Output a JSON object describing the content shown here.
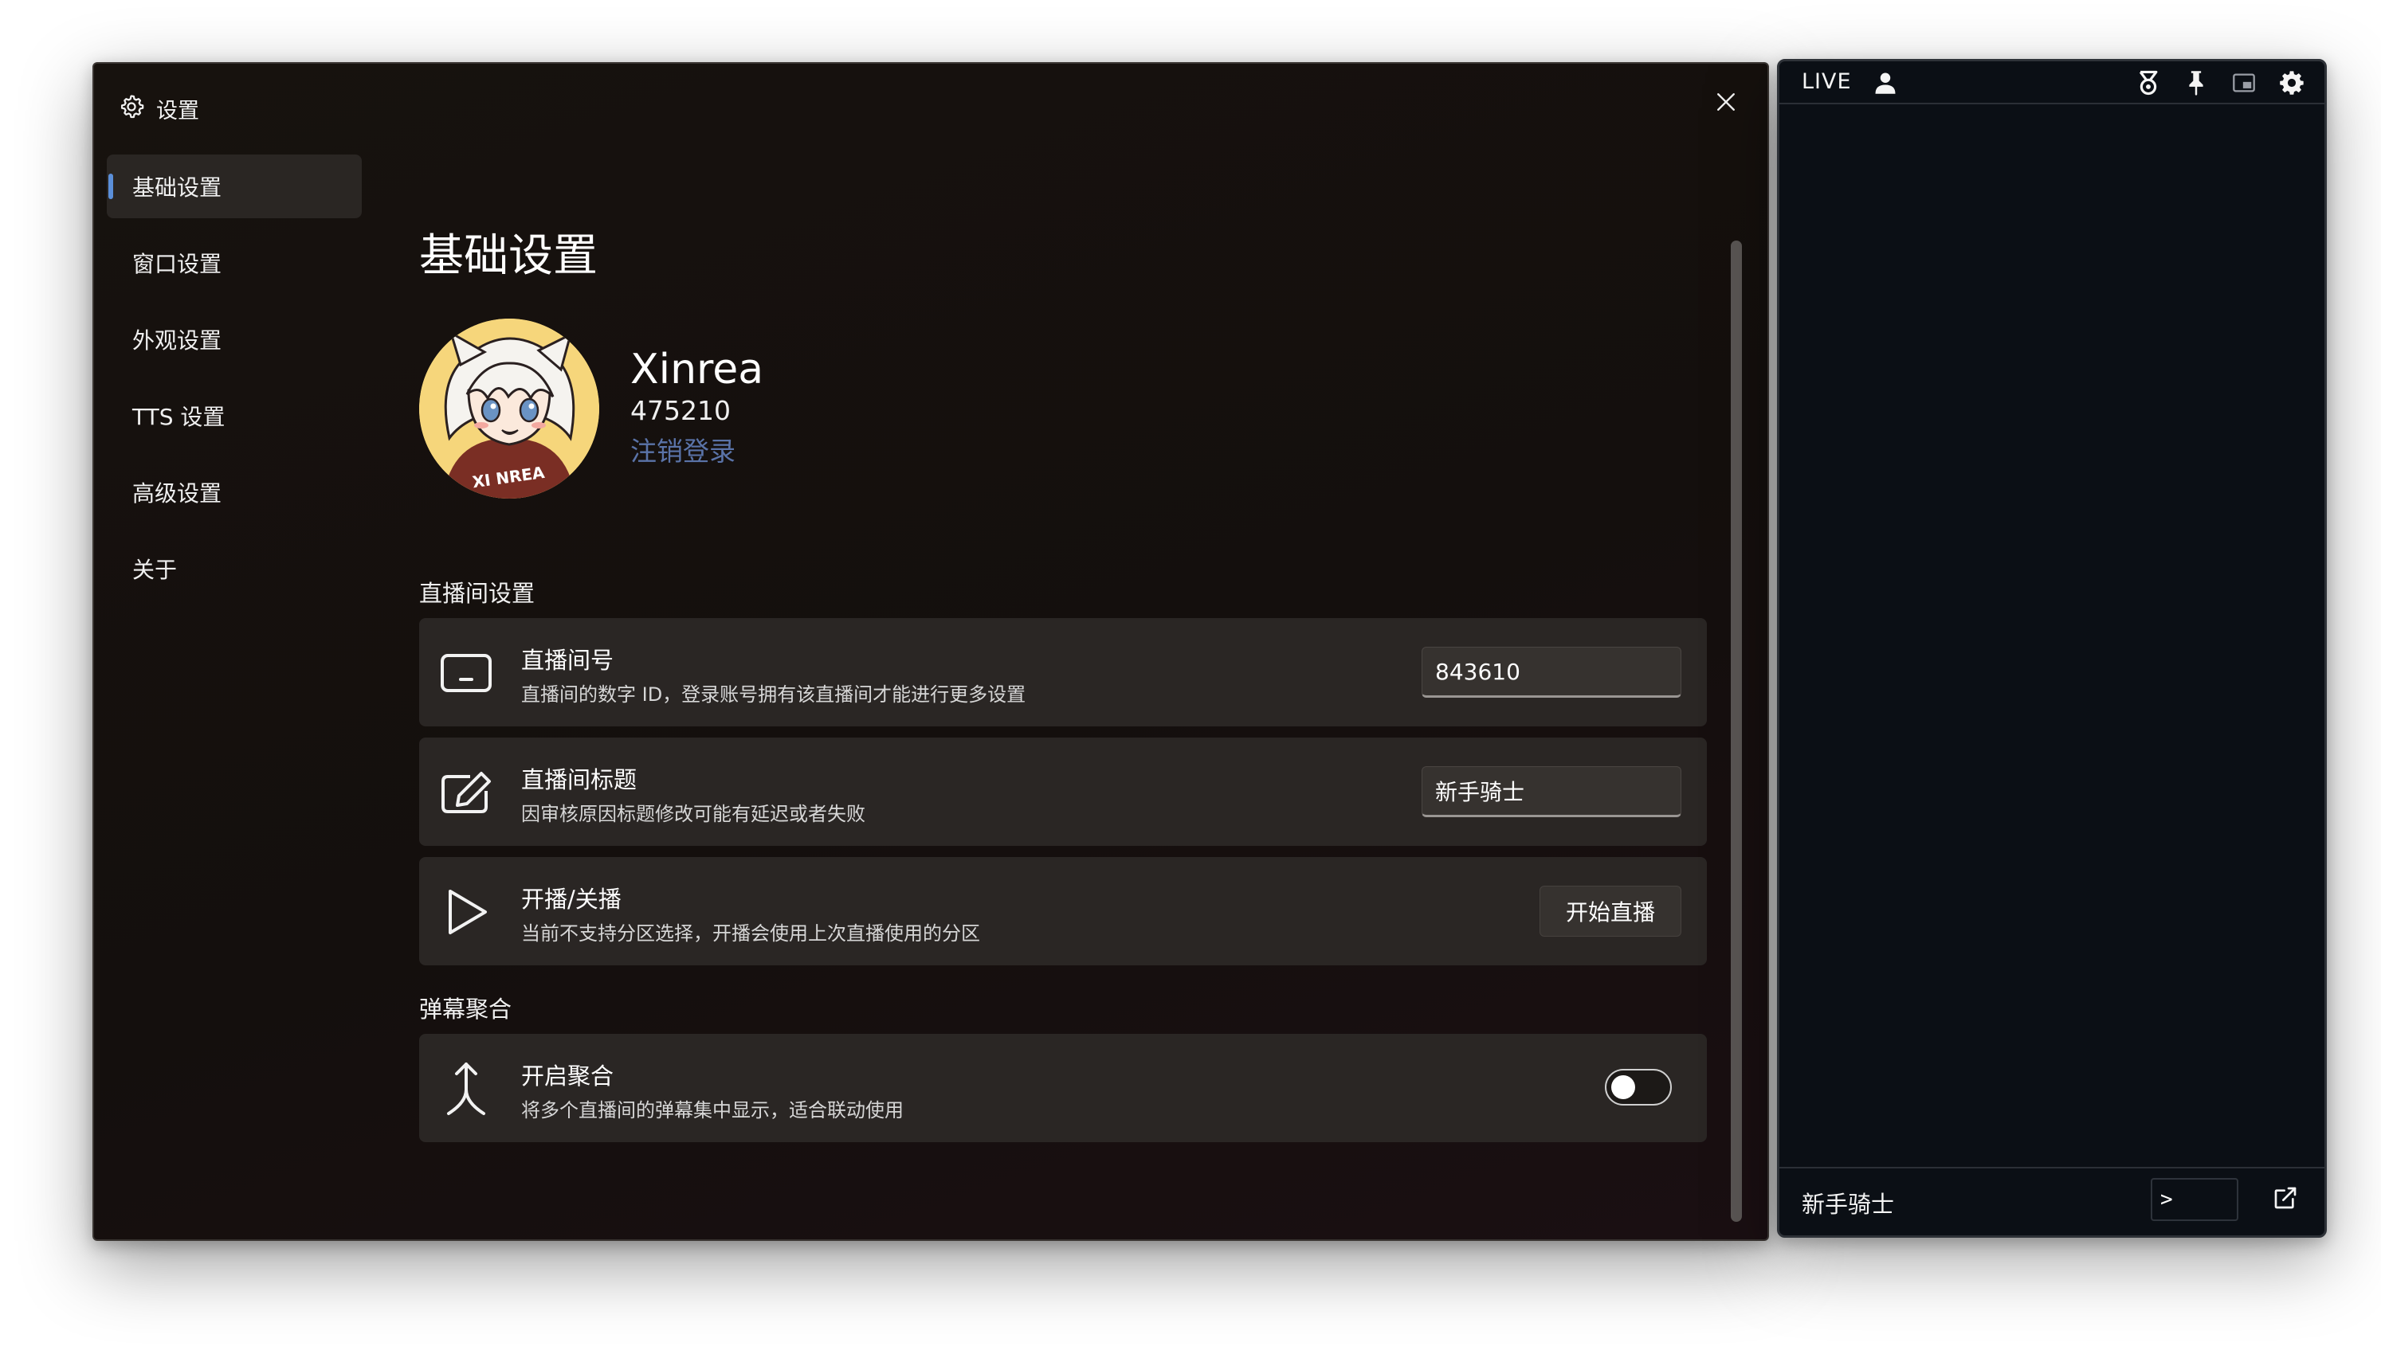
{
  "settings_window": {
    "title": "设置",
    "sidebar": {
      "items": [
        {
          "label": "基础设置",
          "active": true
        },
        {
          "label": "窗口设置"
        },
        {
          "label": "外观设置"
        },
        {
          "label": "TTS 设置"
        },
        {
          "label": "高级设置"
        },
        {
          "label": "关于"
        }
      ]
    },
    "page_title": "基础设置",
    "profile": {
      "username": "Xinrea",
      "user_id": "475210",
      "logout_label": "注销登录",
      "avatar_caption": "XI NREA"
    },
    "sections": {
      "live_room": {
        "title": "直播间设置",
        "room_id": {
          "title": "直播间号",
          "description": "直播间的数字 ID，登录账号拥有该直播间才能进行更多设置",
          "value": "843610",
          "icon": "tablet-icon"
        },
        "room_title": {
          "title": "直播间标题",
          "description": "因审核原因标题修改可能有延迟或者失败",
          "value": "新手骑士",
          "icon": "edit-icon"
        },
        "broadcast": {
          "title": "开播/关播",
          "description": "当前不支持分区选择，开播会使用上次直播使用的分区",
          "button_label": "开始直播",
          "icon": "play-icon"
        }
      },
      "danmaku": {
        "title": "弹幕聚合",
        "merge": {
          "title": "开启聚合",
          "description": "将多个直播间的弹幕集中显示，适合联动使用",
          "enabled": false,
          "icon": "merge-arrow-icon"
        }
      }
    }
  },
  "live_panel": {
    "label": "LIVE",
    "footer_title": "新手骑士",
    "command_value": ">",
    "icons": [
      "user-icon",
      "medal-icon",
      "pin-icon",
      "picture-in-picture-icon",
      "gear-icon",
      "external-link-icon"
    ]
  },
  "colors": {
    "accent": "#5b8fd9",
    "link": "#5a73a8",
    "card_bg": "#2a2624",
    "live_bg": "#0b0f15"
  }
}
